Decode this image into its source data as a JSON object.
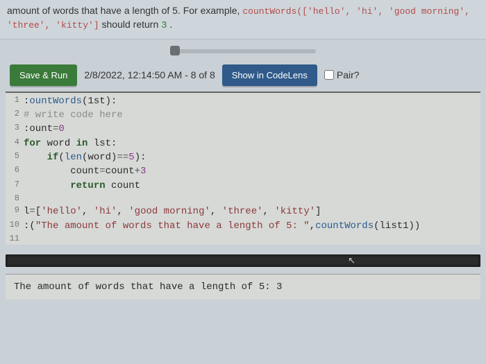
{
  "instructions": {
    "pre": "amount of words that have a length of 5. For example, ",
    "call": "countWords(['hello', 'hi', 'good morning', 'three', 'kitty']",
    "mid": " should return ",
    "retval": "3",
    "post": "."
  },
  "toolbar": {
    "save_run": "Save & Run",
    "run_info": "2/8/2022, 12:14:50 AM - 8 of 8",
    "codelens": "Show in CodeLens",
    "pair": "Pair?"
  },
  "code": {
    "l1": {
      "n": "1",
      "a": ":",
      "b": "ountWords",
      "c": "(",
      "d": "1st",
      "e": "):"
    },
    "l2": {
      "n": "2",
      "a": "#",
      "b": " write code here"
    },
    "l3": {
      "n": "3",
      "a": ":",
      "b": "ount",
      "c": "=",
      "d": "0"
    },
    "l4": {
      "n": "4",
      "a": "for",
      "b": " word ",
      "c": "in",
      "d": " lst:"
    },
    "l5": {
      "n": "5",
      "a": "    if",
      "b": "(",
      "c": "len",
      "d": "(word)",
      "e": "==",
      "f": "5",
      "g": "):"
    },
    "l6": {
      "n": "6",
      "a": "        count",
      "b": "=",
      "c": "count",
      "d": "+",
      "e": "3"
    },
    "l7": {
      "n": "7",
      "a": "        ",
      "b": "return",
      "c": " count"
    },
    "l8": {
      "n": "8",
      "a": ""
    },
    "l9": {
      "n": "9",
      "a": "l",
      "b": "=",
      "c": "[",
      "d": "'hello'",
      "e": ", ",
      "f": "'hi'",
      "g": ", ",
      "h": "'good morning'",
      "i": ", ",
      "j": "'three'",
      "k": ", ",
      "l": "'kitty'",
      "m": "]"
    },
    "l10": {
      "n": "10",
      "a": ":",
      "b": "(",
      "c": "\"The amount of words that have a length of 5: \"",
      "d": ",",
      "e": "countWords",
      "f": "(list1))"
    },
    "l11": {
      "n": "11",
      "a": ""
    }
  },
  "output": {
    "text": "The amount of words that have a length of 5:  3"
  }
}
